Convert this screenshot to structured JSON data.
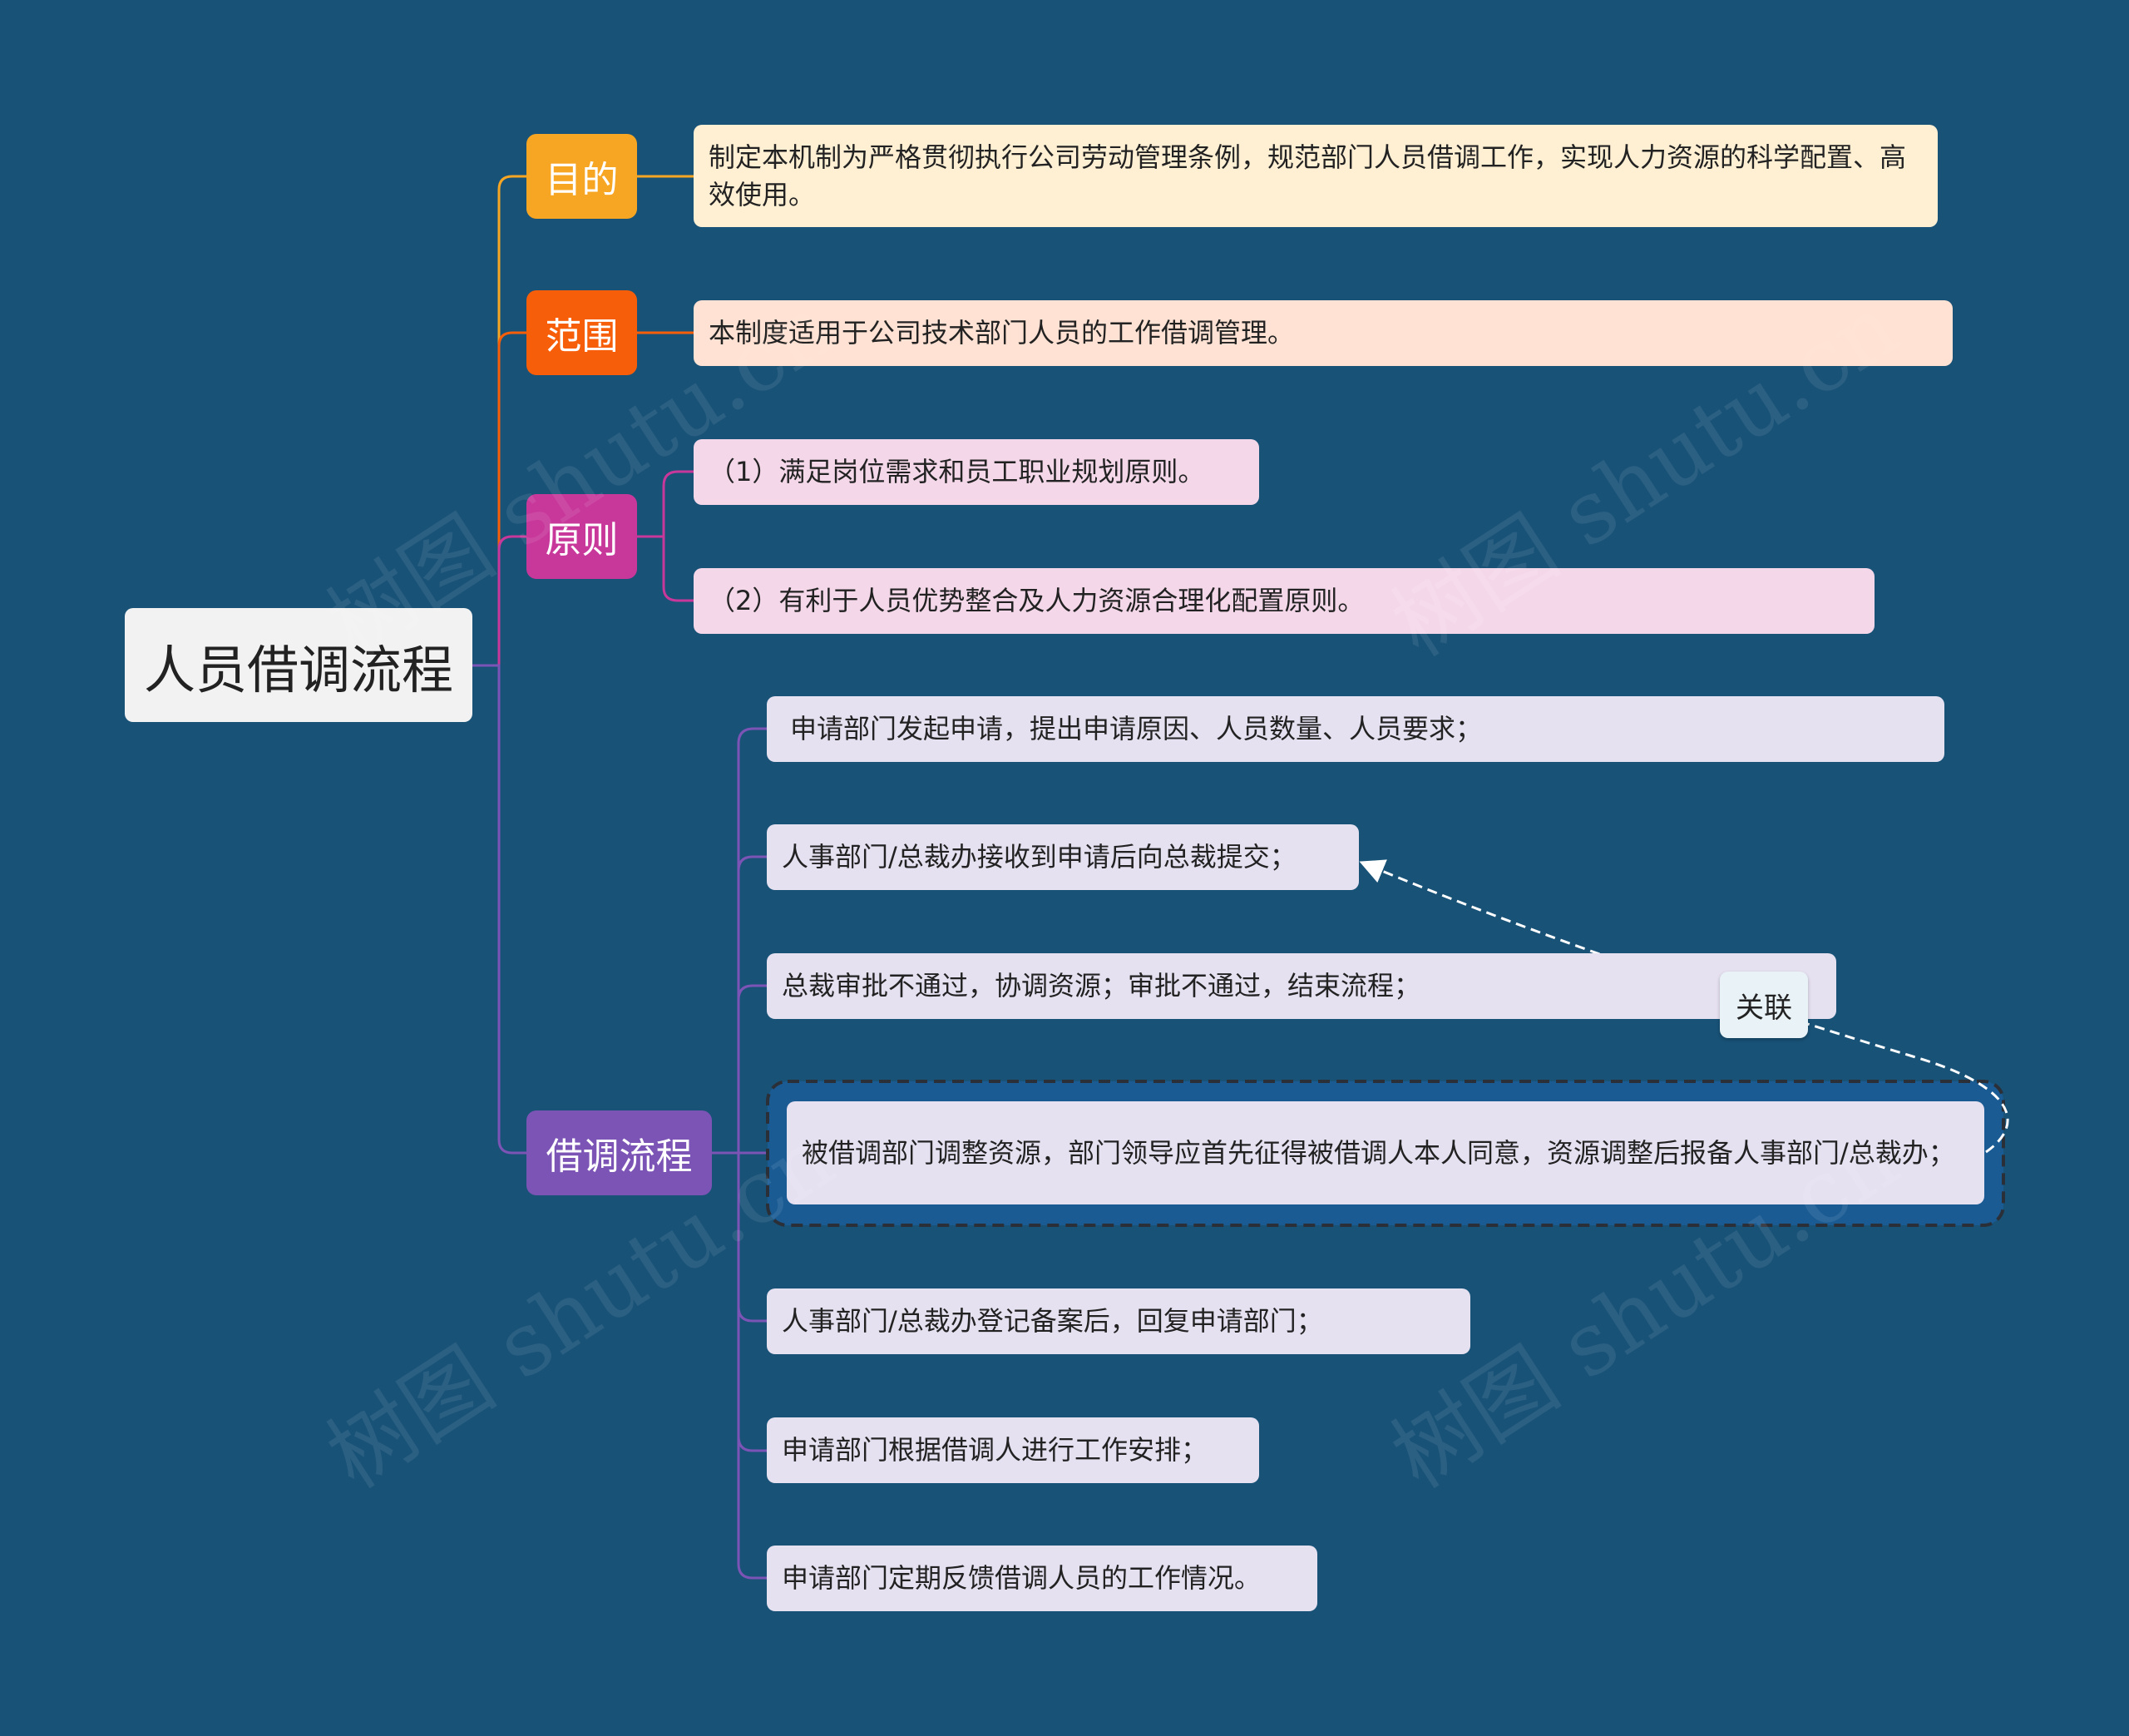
{
  "root": {
    "label": "人员借调流程"
  },
  "colors": {
    "background": "#185277",
    "root_fill": "#f2f2f2",
    "purpose": "#f7a623",
    "scope": "#f75e0a",
    "principle": "#c8389b",
    "process": "#7c54b5",
    "purpose_leaf": "#fff0d4",
    "scope_leaf": "#ffe2d3",
    "principle_leaf": "#f4d8ea",
    "process_leaf": "#e6e1f1",
    "highlight_frame": "#1a5b93",
    "association_label": "#e9f2f7"
  },
  "branches": [
    {
      "id": "purpose",
      "label": "目的",
      "children": [
        "制定本机制为严格贯彻执行公司劳动管理条例，规范部门人员借调工作，实现人力资源的科学配置、高效使用。"
      ]
    },
    {
      "id": "scope",
      "label": "范围",
      "children": [
        "本制度适用于公司技术部门人员的工作借调管理。"
      ]
    },
    {
      "id": "principle",
      "label": "原则",
      "children": [
        "（1）满足岗位需求和员工职业规划原则。",
        "（2）有利于人员优势整合及人力资源合理化配置原则。"
      ]
    },
    {
      "id": "process",
      "label": "借调流程",
      "children": [
        "申请部门发起申请，提出申请原因、人员数量、人员要求；",
        "人事部门/总裁办接收到申请后向总裁提交；",
        "总裁审批不通过，协调资源；审批不通过，结束流程；",
        "被借调部门调整资源，部门领导应首先征得被借调人本人同意，资源调整后报备人事部门/总裁办；",
        "人事部门/总裁办登记备案后，回复申请部门；",
        "申请部门根据借调人进行工作安排；",
        "申请部门定期反馈借调人员的工作情况。"
      ]
    }
  ],
  "association": {
    "label": "关联",
    "from": "process.3",
    "to": "process.1"
  },
  "watermark": "树图 shutu.cn"
}
